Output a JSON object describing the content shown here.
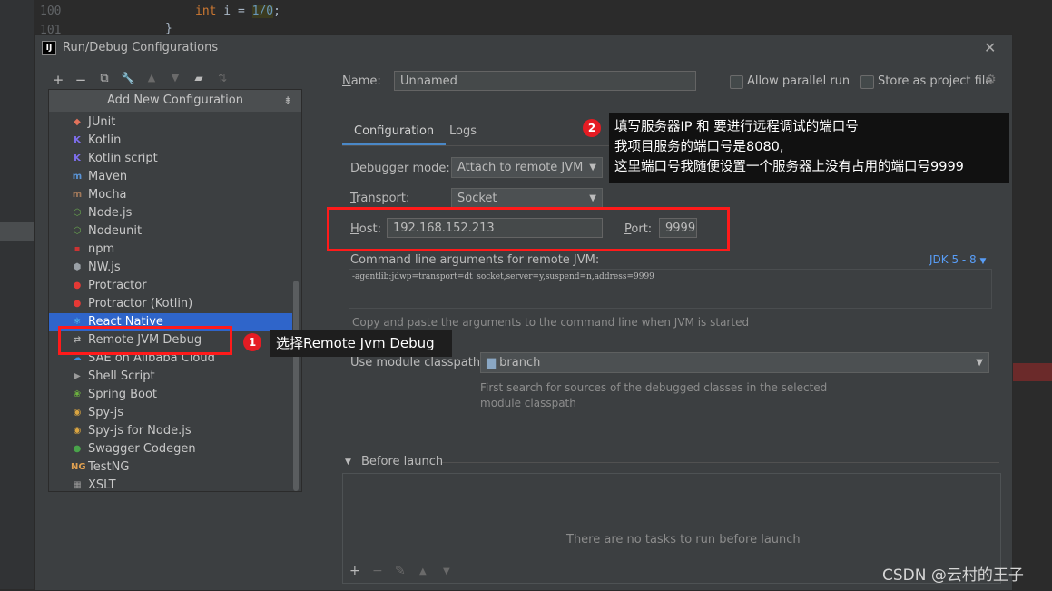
{
  "editor": {
    "line_numbers": [
      "100",
      "101"
    ],
    "code_line": "int i = 1/0;",
    "code_kw": "int",
    "code_var": " i = ",
    "code_num": "1/0",
    "code_end": ";",
    "brace": "}"
  },
  "dialog": {
    "title": "Run/Debug Configurations",
    "app_icon": "IJ",
    "close_icon": "close-icon",
    "toolbar": {
      "add": "+",
      "remove": "−",
      "copy": "⧉",
      "edit": "🔧",
      "up": "▲",
      "down": "▼",
      "folder": "▰",
      "sort": "⇅"
    }
  },
  "config_list": {
    "header": "Add New Configuration",
    "header_icon": "⇟",
    "items": [
      {
        "label": "JUnit",
        "icon": "junit-icon",
        "glyph": "◆",
        "color": "#e2725b"
      },
      {
        "label": "Kotlin",
        "icon": "kotlin-icon",
        "glyph": "K",
        "color": "#7f6ff0"
      },
      {
        "label": "Kotlin script",
        "icon": "kotlin-script-icon",
        "glyph": "K",
        "color": "#7f6ff0"
      },
      {
        "label": "Maven",
        "icon": "maven-icon",
        "glyph": "m",
        "color": "#5a94d6"
      },
      {
        "label": "Mocha",
        "icon": "mocha-icon",
        "glyph": "m",
        "color": "#a0785a"
      },
      {
        "label": "Node.js",
        "icon": "nodejs-icon",
        "glyph": "⬡",
        "color": "#6aa84f"
      },
      {
        "label": "Nodeunit",
        "icon": "nodeunit-icon",
        "glyph": "⬡",
        "color": "#6aa84f"
      },
      {
        "label": "npm",
        "icon": "npm-icon",
        "glyph": "▪",
        "color": "#cc3333"
      },
      {
        "label": "NW.js",
        "icon": "nwjs-icon",
        "glyph": "⬢",
        "color": "#9aa0a6"
      },
      {
        "label": "Protractor",
        "icon": "protractor-icon",
        "glyph": "●",
        "color": "#e53935"
      },
      {
        "label": "Protractor (Kotlin)",
        "icon": "protractor-kotlin-icon",
        "glyph": "●",
        "color": "#e53935"
      },
      {
        "label": "React Native",
        "icon": "react-native-icon",
        "glyph": "⚛",
        "color": "#61dafb"
      },
      {
        "label": "Remote JVM Debug",
        "icon": "remote-jvm-debug-icon",
        "glyph": "⇄",
        "color": "#aaaaaa"
      },
      {
        "label": "SAE on Alibaba Cloud",
        "icon": "alibaba-cloud-icon",
        "glyph": "☁",
        "color": "#3a8fe0"
      },
      {
        "label": "Shell Script",
        "icon": "shell-script-icon",
        "glyph": "▶",
        "color": "#9a9a9a"
      },
      {
        "label": "Spring Boot",
        "icon": "spring-boot-icon",
        "glyph": "❀",
        "color": "#6db33f"
      },
      {
        "label": "Spy-js",
        "icon": "spy-js-icon",
        "glyph": "◉",
        "color": "#d9a441"
      },
      {
        "label": "Spy-js for Node.js",
        "icon": "spy-js-node-icon",
        "glyph": "◉",
        "color": "#d9a441"
      },
      {
        "label": "Swagger Codegen",
        "icon": "swagger-icon",
        "glyph": "●",
        "color": "#49a34a"
      },
      {
        "label": "TestNG",
        "icon": "testng-icon",
        "glyph": "NG",
        "color": "#e0a050"
      },
      {
        "label": "XSLT",
        "icon": "xslt-icon",
        "glyph": "▦",
        "color": "#9a9a9a"
      }
    ],
    "selected": "React Native"
  },
  "form": {
    "name_label": "Name:",
    "name_value": "Unnamed",
    "allow_parallel": "Allow parallel run",
    "store_project": "Store as project file",
    "tabs": [
      "Configuration",
      "Logs"
    ],
    "debugger_mode_label": "Debugger mode:",
    "debugger_mode_value": "Attach to remote JVM",
    "transport_label": "Transport:",
    "transport_value": "Socket",
    "host_label": "Host:",
    "host_value": "192.168.152.213",
    "port_label": "Port:",
    "port_value": "9999",
    "cmd_label": "Command line arguments for remote JVM:",
    "jdk_link": "JDK 5 - 8",
    "cmd_value": "-agentlib:jdwp=transport=dt_socket,server=y,suspend=n,address=9999",
    "cmd_hint": "Copy and paste the arguments to the command line when JVM is started",
    "module_label": "Use module classpath:",
    "module_value": "branch",
    "module_hint_1": "First search for sources of the debugged classes in the selected",
    "module_hint_2": "module classpath",
    "before_launch": "Before launch",
    "before_empty": "There are no tasks to run before launch",
    "bl_toolbar": {
      "add": "+",
      "remove": "−",
      "edit": "✎",
      "up": "▲",
      "down": "▼"
    }
  },
  "annotations": {
    "badge1": "1",
    "note1": "选择Remote Jvm Debug",
    "badge2": "2",
    "note2_line1": "填写服务器IP 和 要进行远程调试的端口号",
    "note2_line2": "我项目服务的端口号是8080,",
    "note2_line3": "这里端口号我随便设置一个服务器上没有占用的端口号9999",
    "watermark": "CSDN @云村的王子",
    "colors": {
      "highlight": "#ff1a1a",
      "badge": "#e51c23",
      "selection": "#2f65ca",
      "link": "#589df6"
    }
  }
}
